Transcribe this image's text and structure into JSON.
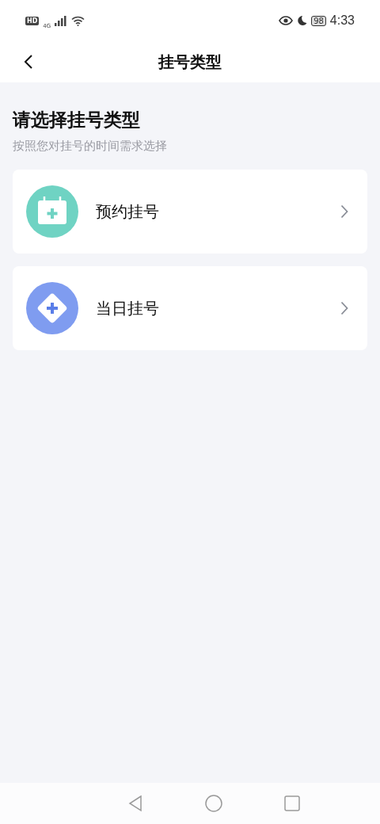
{
  "status_bar": {
    "hd": "HD",
    "network": "4G",
    "battery": "98",
    "time": "4:33"
  },
  "nav_bar": {
    "title": "挂号类型"
  },
  "heading": "请选择挂号类型",
  "subtitle": "按照您对挂号的时间需求选择",
  "options": [
    {
      "label": "预约挂号",
      "kind": "calendar",
      "color": "#6fd3c3"
    },
    {
      "label": "当日挂号",
      "kind": "diamond",
      "color": "#7f9cf0"
    }
  ]
}
